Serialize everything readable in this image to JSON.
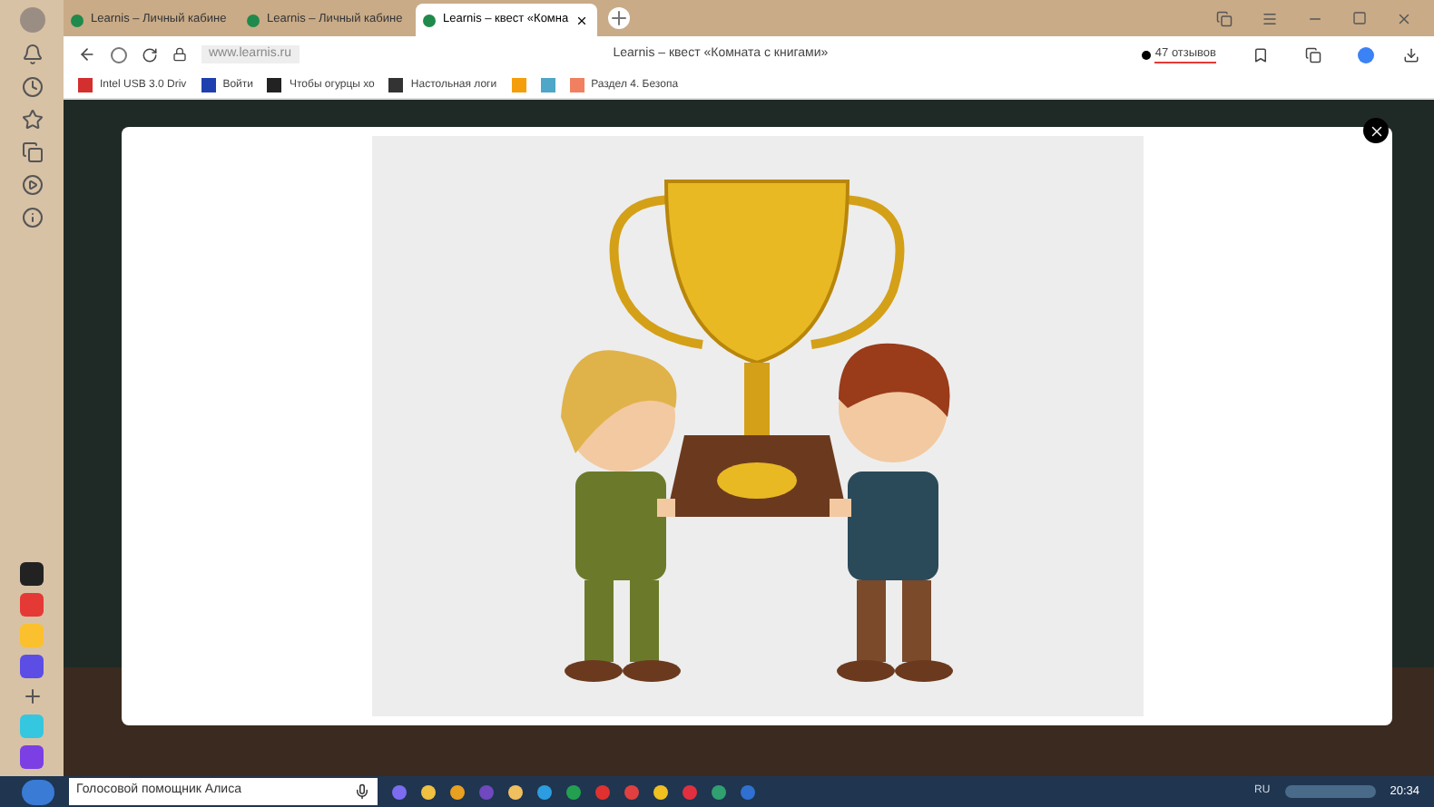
{
  "tabs": [
    {
      "title": "Learnis – Личный кабине",
      "selected": false
    },
    {
      "title": "Learnis – Личный кабине",
      "selected": false
    },
    {
      "title": "Learnis – квест «Комна",
      "selected": true
    }
  ],
  "address_bar": {
    "url": "www.learnis.ru",
    "page_title": "Learnis – квест «Комната с книгами»",
    "reviews": "47 отзывов"
  },
  "bookmarks": [
    {
      "label": "Intel USB 3.0 Driv",
      "color": "#d32f2f"
    },
    {
      "label": "Войти",
      "color": "#1e40af"
    },
    {
      "label": "Чтобы огурцы хо",
      "color": "#222222"
    },
    {
      "label": "Настольная логи",
      "color": "#333333"
    },
    {
      "color": "#f59e0b"
    },
    {
      "color": "#4ea6c8"
    },
    {
      "label": "Раздел 4. Безопа",
      "color": "#f08060"
    }
  ],
  "taskbar": {
    "search": {
      "placeholder": "Голосовой помощник Алиса"
    },
    "language": "RU",
    "time": "20:34"
  }
}
